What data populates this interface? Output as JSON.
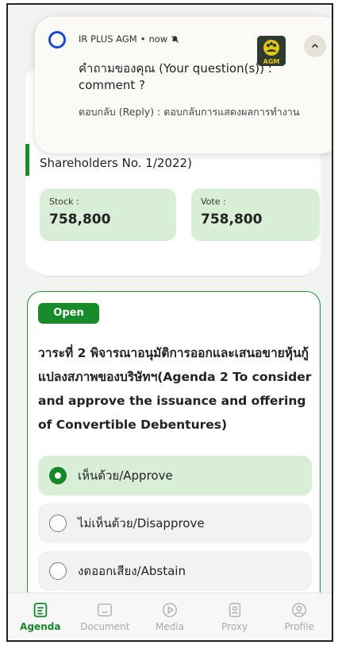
{
  "meeting": {
    "title_tail": "Shareholders No. 1/2022)",
    "stock_label": "Stock :",
    "stock_value": "758,800",
    "vote_label": "Vote :",
    "vote_value": "758,800"
  },
  "agenda": {
    "status": "Open",
    "title": "วาระที่ 2 พิจารณาอนุมัติการออกและเสนอขายหุ้นกู้แปลงสภาพของบริษัทฯ(Agenda 2 To consider and approve the issuance and offering of Convertible Debentures)",
    "choices": [
      {
        "label": "เห็นด้วย/Approve",
        "selected": true
      },
      {
        "label": "ไม่เห็นด้วย/Disapprove",
        "selected": false
      },
      {
        "label": "งดออกเสียง/Abstain",
        "selected": false
      }
    ]
  },
  "nav": {
    "items": [
      {
        "label": "Agenda",
        "icon": "agenda-icon",
        "active": true
      },
      {
        "label": "Document",
        "icon": "document-icon",
        "active": false
      },
      {
        "label": "Media",
        "icon": "media-icon",
        "active": false
      },
      {
        "label": "Proxy",
        "icon": "proxy-icon",
        "active": false
      },
      {
        "label": "Profile",
        "icon": "profile-icon",
        "active": false
      }
    ]
  },
  "notification": {
    "app_name": "IR PLUS AGM",
    "time": "now",
    "body_line1": "คำถามของคุณ (Your question(s)) : comment ?",
    "body_line2": "ตอบกลับ (Reply) : ตอบกลับการแสดงผลการทำงาน",
    "logo_text": "AGM"
  },
  "colors": {
    "accent": "#16872a",
    "selected_bg": "#d9eed6",
    "app_icon_ring": "#1d4ad1"
  }
}
